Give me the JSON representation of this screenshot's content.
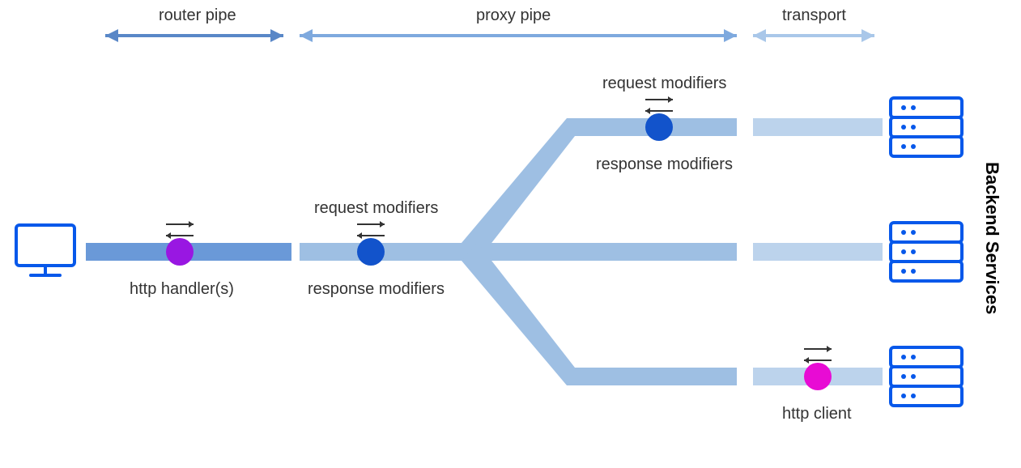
{
  "sections": {
    "router_pipe": "router pipe",
    "proxy_pipe": "proxy pipe",
    "transport": "transport"
  },
  "nodes": {
    "http_handlers": "http handler(s)",
    "proxy_request_modifiers": "request modifiers",
    "proxy_response_modifiers": "response modifiers",
    "branch_request_modifiers": "request modifiers",
    "branch_response_modifiers": "response modifiers",
    "http_client": "http client"
  },
  "side_label": "Backend Services",
  "colors": {
    "router_pipe_fill": "#6A99D8",
    "proxy_pipe_fill": "#9EBFE3",
    "transport_fill": "#BCD3EC",
    "router_arrow": "#5987C7",
    "proxy_arrow": "#7EA9DE",
    "transport_arrow": "#A9C7E9",
    "handler_dot": "#9917E2",
    "modifier_dot": "#1253CB",
    "client_dot": "#E80BD4",
    "server_stroke": "#0758EA",
    "direction_arrow": "#333333"
  }
}
